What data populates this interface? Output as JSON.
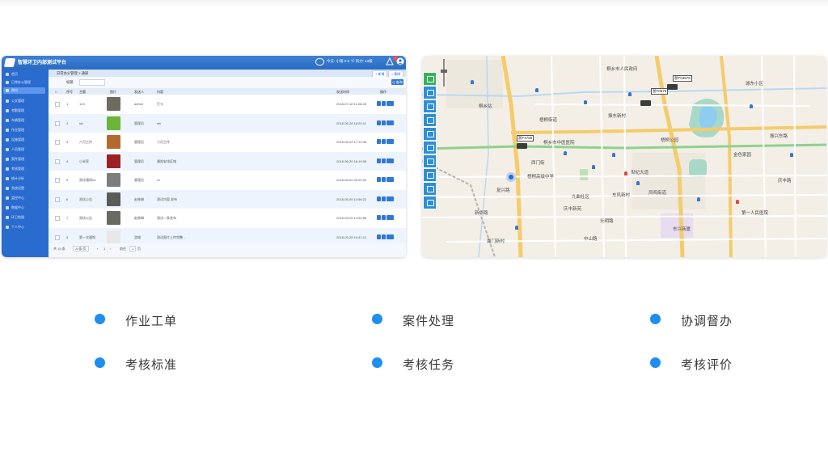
{
  "app": {
    "title": "智慧环卫内部测试平台",
    "weather": "今天: 小雨 0-5 ℃ 风力: ≤3级",
    "breadcrumb": "日常办公管理 > 通知",
    "toolbar": {
      "add_label": "+ 新增",
      "delete_label": "× 删除"
    },
    "search": {
      "label": "标题",
      "button_label": "Q 查询"
    },
    "sidebar": [
      {
        "label": "首页"
      },
      {
        "label": "日常办公管理"
      },
      {
        "label": "通知"
      },
      {
        "label": "公文管理"
      },
      {
        "label": "考勤管理"
      },
      {
        "label": "车辆管理"
      },
      {
        "label": "作业管理"
      },
      {
        "label": "设施管理"
      },
      {
        "label": "人员管理"
      },
      {
        "label": "案件管理"
      },
      {
        "label": "考核管理"
      },
      {
        "label": "统计分析"
      },
      {
        "label": "系统设置"
      },
      {
        "label": "监控中心"
      },
      {
        "label": "数据中心"
      },
      {
        "label": "环卫地图"
      },
      {
        "label": "个人中心"
      }
    ],
    "table": {
      "headers": [
        "序号",
        "主题",
        "图片",
        "发送人",
        "内容",
        "发送时间",
        "操作"
      ],
      "rows": [
        {
          "no": "1",
          "subject": "123",
          "sender": "admin",
          "content": "打卡",
          "time": "2018-07-18 11:06:28",
          "thumb_color": "#6f6a5e"
        },
        {
          "no": "2",
          "subject": "sfc",
          "sender": "管理员",
          "content": "sfc",
          "time": "2018-06-28 18:20:11",
          "thumb_color": "#6db43a"
        },
        {
          "no": "3",
          "subject": "六月工作",
          "sender": "管理员",
          "content": "六月工作",
          "time": "2018-06-24 17:10:45",
          "thumb_color": "#b46a2e"
        },
        {
          "no": "4",
          "subject": "小米家",
          "sender": "管理员",
          "content": "通知安排区域",
          "time": "2018-06-20 16:19:28",
          "thumb_color": "#9a2222"
        },
        {
          "no": "5",
          "subject": "测试通知04",
          "sender": "管理员",
          "content": "xx",
          "time": "2018-06-02 09:03:32",
          "thumb_color": "#7d7d7d"
        },
        {
          "no": "6",
          "subject": "测试公告",
          "sender": "赵林琳",
          "content": "测试内容,发布",
          "time": "2018-05-09 14:56:22",
          "thumb_color": "#5b5b58"
        },
        {
          "no": "7",
          "subject": "测试公告",
          "sender": "赵林琳",
          "content": "测试一条发布",
          "time": "2018-05-09 14:50:58",
          "thumb_color": "#6a6a62"
        },
        {
          "no": "8",
          "subject": "第一次通知",
          "sender": "游城",
          "content": "测试图片上传完整...",
          "time": "2018-05-28 16:41:12",
          "thumb_color": "#e8e8e8"
        }
      ]
    },
    "pager": {
      "total": "共 15 条",
      "page_size": "20条/页",
      "page": "1",
      "goto": "前往",
      "goto_page": "1",
      "page_unit": "页"
    }
  },
  "map": {
    "labels": [
      {
        "text": "桐乡站"
      },
      {
        "text": "梧桐街道"
      },
      {
        "text": "振东新村"
      },
      {
        "text": "桐乡市中医医院"
      },
      {
        "text": "西门街"
      },
      {
        "text": "梧桐高级中学"
      },
      {
        "text": "复兴路"
      },
      {
        "text": "九曲社区"
      },
      {
        "text": "东风新村"
      },
      {
        "text": "庆丰新苑"
      },
      {
        "text": "新华路"
      },
      {
        "text": "光明路"
      },
      {
        "text": "梧桐公园"
      },
      {
        "text": "第一人民医院"
      },
      {
        "text": "世纪大道"
      },
      {
        "text": "凤鸣街道"
      },
      {
        "text": "南门新村"
      },
      {
        "text": "中山路"
      },
      {
        "text": "东兴商厦"
      },
      {
        "text": "庆丰路"
      },
      {
        "text": "桐乡市人民政府"
      },
      {
        "text": "城东小区"
      },
      {
        "text": "金色家园"
      },
      {
        "text": "振兴东路"
      }
    ],
    "vehicles": [
      {
        "tag": "浙F0578"
      },
      {
        "tag": "浙F03578"
      },
      {
        "tag": "浙F4780"
      }
    ],
    "toolbar_icons": [
      "truck-icon",
      "sweeper-icon",
      "car-icon",
      "bin-icon",
      "station-icon",
      "toilet-icon",
      "building-icon",
      "water-icon",
      "person-icon",
      "other-icon"
    ]
  },
  "features": [
    {
      "label": "作业工单"
    },
    {
      "label": "案件处理"
    },
    {
      "label": "协调督办"
    },
    {
      "label": "考核标准"
    },
    {
      "label": "考核任务"
    },
    {
      "label": "考核评价"
    }
  ],
  "colors": {
    "accent": "#1f8ef1",
    "app_header": "#2a6bc2",
    "sidebar": "#2a6bd0"
  }
}
